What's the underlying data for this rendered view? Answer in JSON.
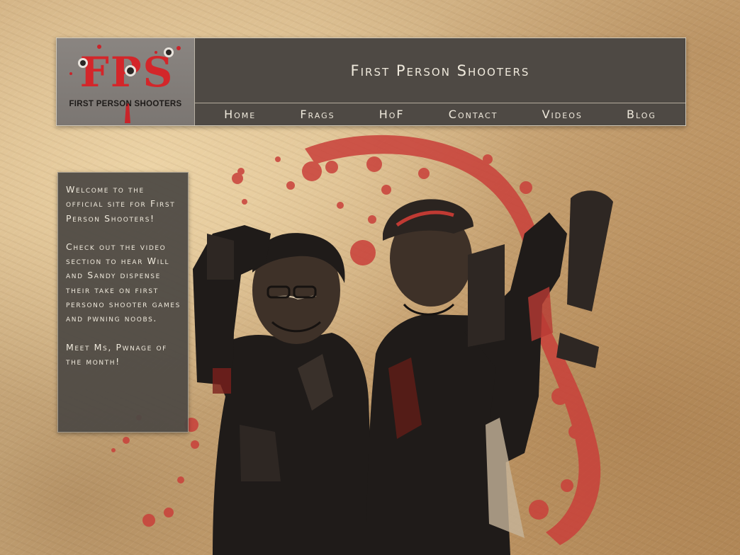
{
  "header": {
    "logo_mark": "FPS",
    "logo_text": "FIRST PERSON SHOOTERS",
    "site_title": "First Person Shooters"
  },
  "nav": {
    "items": [
      "Home",
      "Frags",
      "HoF",
      "Contact",
      "Videos",
      "Blog"
    ]
  },
  "welcome": {
    "paragraphs": [
      "Welcome to the official site for First Person Shooters!",
      "Check out the video section to hear Will and Sandy dispense their take on first persono shooter games and pwning noobs.",
      "Meet Ms, Pwnage of the month!"
    ]
  },
  "colors": {
    "panel": "#4e4944",
    "text": "#efe9dc",
    "blood": "#c93a33",
    "background": "#d2b184"
  },
  "icons": {
    "bullet_hole": "bullet-hole-icon"
  }
}
